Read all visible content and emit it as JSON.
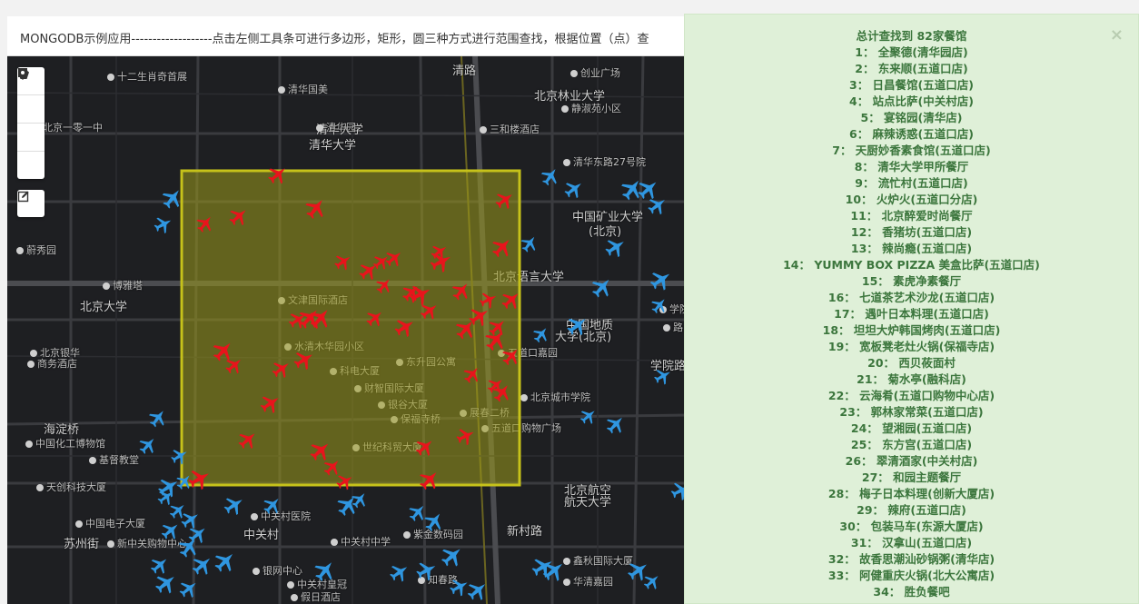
{
  "header": {
    "text": "MONGODB示例应用-------------------点击左侧工具条可进行多边形，矩形，圆三种方式进行范围查找，根据位置（点）查"
  },
  "colors": {
    "restaurant_in": "#e8141c",
    "restaurant_out": "#2f96e0",
    "selection_fill": "#9c9a1b",
    "selection_stroke": "#c6c21a",
    "panel_bg": "#dff0d8",
    "panel_text": "#3c763d"
  },
  "toolbar": {
    "tools": [
      {
        "name": "polygon",
        "icon": "pentagon-icon"
      },
      {
        "name": "rectangle",
        "icon": "square-icon"
      },
      {
        "name": "circle",
        "icon": "circle-icon"
      },
      {
        "name": "point",
        "icon": "map-pin-icon"
      }
    ],
    "edit": {
      "icon": "edit-icon"
    }
  },
  "map_labels": [
    "十二生肖奇首展",
    "清华国美",
    "北京一零一中",
    "清华大学",
    "清华大学",
    "清华园",
    "三和楼酒店",
    "创业广场",
    "北京林业大学",
    "静淑苑小区",
    "清华东路27号院",
    "中国矿业大学",
    "(北京)",
    "北京语言大学",
    "北京大学",
    "博雅塔",
    "蔚秀园",
    "文津国际酒店",
    "北京银华",
    "商务酒店",
    "水清木华园小区",
    "科电大厦",
    "东升园公寓",
    "五道口嘉园",
    "财智国际大厦",
    "银谷大厦",
    "保福寺桥",
    "展春二桥",
    "北京城市学院",
    "中国地质",
    "大学(北京)",
    "海淀桥",
    "中国化工博物馆",
    "基督教堂",
    "天创科技大厦",
    "世纪科贸大厦",
    "五道口购物广场",
    "中关村医院",
    "中关村",
    "北京航空",
    "航天大学",
    "中国电子大厦",
    "新中关购物中心",
    "紫金数码园",
    "中关村中学",
    "苏州街",
    "银网中心",
    "中关村皇冠",
    "假日酒店",
    "知春路",
    "华清嘉园",
    "鑫秋国际大厦",
    "新村路",
    "清路",
    "学院路",
    "学院",
    "路"
  ],
  "results": {
    "summary": "总计查找到 82家餐馆",
    "items": [
      "1： 全聚德(清华园店)",
      "2： 东来顺(五道口店)",
      "3： 日昌餐馆(五道口店)",
      "4： 站点比萨(中关村店)",
      "5： 宴铭园(清华店)",
      "6： 麻辣诱惑(五道口店)",
      "7： 天厨妙香素食馆(五道口店)",
      "8： 清华大学甲所餐厅",
      "9： 流忙村(五道口店)",
      "10： 火炉火(五道口分店)",
      "11： 北京醉爱时尚餐厅",
      "12： 香猪坊(五道口店)",
      "13： 辣尚瘾(五道口店)",
      "14： YUMMY BOX PIZZA 美盒比萨(五道口店)",
      "15： 素虎净素餐厅",
      "16： 七道茶艺术沙龙(五道口店)",
      "17： 遇叶日本料理(五道口店)",
      "18： 坦坦大炉韩国烤肉(五道口店)",
      "19： 宽板凳老灶火锅(保福寺店)",
      "20： 西贝莜面村",
      "21： 菊水亭(融科店)",
      "22： 云海肴(五道口购物中心店)",
      "23： 郭林家常菜(五道口店)",
      "24： 望湘园(五道口店)",
      "25： 东方宫(五道口店)",
      "26： 翠清酒家(中关村店)",
      "27： 和园主题餐厅",
      "28： 梅子日本料理(创新大厦店)",
      "29： 辣府(五道口店)",
      "30： 包装马车(东源大厦店)",
      "31： 汉拿山(五道口店)",
      "32： 故香思潮汕砂锅粥(清华店)",
      "33： 阿健重庆火锅(北大公寓店)",
      "34： 胜负餐吧"
    ]
  }
}
